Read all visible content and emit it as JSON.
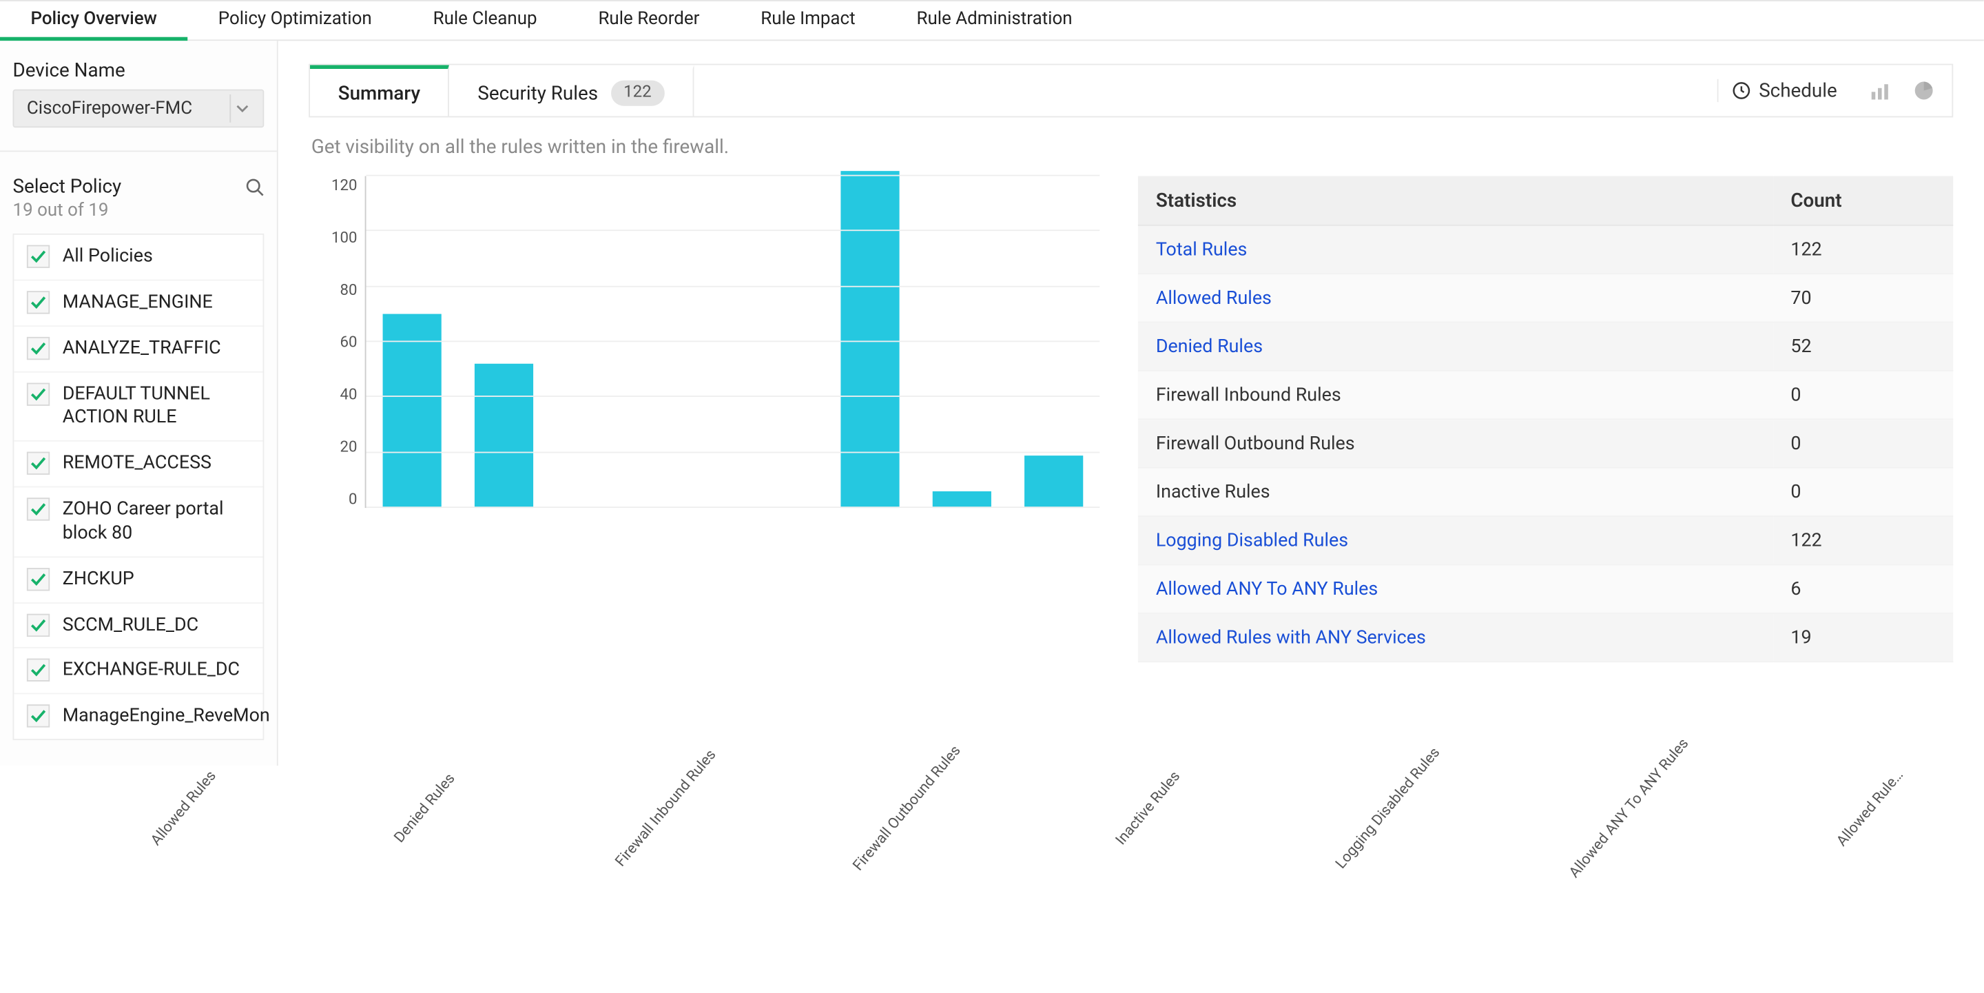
{
  "top_tabs": [
    {
      "label": "Policy Overview",
      "active": true
    },
    {
      "label": "Policy Optimization",
      "active": false
    },
    {
      "label": "Rule Cleanup",
      "active": false
    },
    {
      "label": "Rule Reorder",
      "active": false
    },
    {
      "label": "Rule Impact",
      "active": false
    },
    {
      "label": "Rule Administration",
      "active": false
    }
  ],
  "sidebar": {
    "device_label": "Device Name",
    "device_value": "CiscoFirepower-FMC",
    "select_policy_label": "Select Policy",
    "policy_count": "19 out of 19",
    "policies": [
      "All Policies",
      "MANAGE_ENGINE",
      "ANALYZE_TRAFFIC",
      "DEFAULT TUNNEL ACTION RULE",
      "REMOTE_ACCESS",
      "ZOHO Career portal block 80",
      "ZHCKUP",
      "SCCM_RULE_DC",
      "EXCHANGE-RULE_DC",
      "ManageEngine_ReveMon"
    ]
  },
  "panel_tabs": [
    {
      "label": "Summary",
      "active": true,
      "badge": null
    },
    {
      "label": "Security Rules",
      "active": false,
      "badge": "122"
    }
  ],
  "schedule_label": "Schedule",
  "hint": "Get visibility on all the rules written in the firewall.",
  "stats_header": {
    "col1": "Statistics",
    "col2": "Count"
  },
  "stats": [
    {
      "label": "Total Rules",
      "count": 122,
      "link": true
    },
    {
      "label": "Allowed Rules",
      "count": 70,
      "link": true
    },
    {
      "label": "Denied Rules",
      "count": 52,
      "link": true
    },
    {
      "label": "Firewall Inbound Rules",
      "count": 0,
      "link": false
    },
    {
      "label": "Firewall Outbound Rules",
      "count": 0,
      "link": false
    },
    {
      "label": "Inactive Rules",
      "count": 0,
      "link": false
    },
    {
      "label": "Logging Disabled Rules",
      "count": 122,
      "link": true
    },
    {
      "label": "Allowed ANY To ANY Rules",
      "count": 6,
      "link": true
    },
    {
      "label": "Allowed Rules with ANY Services",
      "count": 19,
      "link": true
    }
  ],
  "chart_data": {
    "type": "bar",
    "title": "",
    "xlabel": "",
    "ylabel": "",
    "ylim": [
      0,
      120
    ],
    "yticks": [
      0,
      20,
      40,
      60,
      80,
      100,
      120
    ],
    "categories": [
      "Allowed Rules",
      "Denied Rules",
      "Firewall Inbound Rules",
      "Firewall Outbound Rules",
      "Inactive Rules",
      "Logging Disabled Rules",
      "Allowed ANY To ANY Rules",
      "Allowed Rule…"
    ],
    "values": [
      70,
      52,
      0,
      0,
      0,
      122,
      6,
      19
    ],
    "bar_color": "#25c8e0"
  }
}
